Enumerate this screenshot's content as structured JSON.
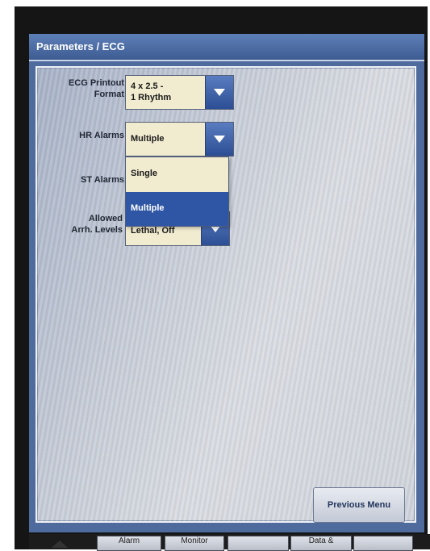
{
  "window": {
    "title": "Parameters / ECG"
  },
  "fields": {
    "printout": {
      "label": "ECG Printout\nFormat",
      "value": "4 x 2.5 -\n1 Rhythm"
    },
    "hr_alarms": {
      "label": "HR Alarms",
      "value": "Multiple"
    },
    "st_alarms": {
      "label": "ST Alarms"
    },
    "arrh_levels": {
      "label": "Allowed\nArrh. Levels",
      "value": "Lethal, Off"
    }
  },
  "dropdown": {
    "options": [
      "Single",
      "Multiple"
    ],
    "selected": "Multiple"
  },
  "buttons": {
    "previous_menu": "Previous Menu"
  },
  "bottom_tabs": [
    "Alarm",
    "Monitor",
    "Data &"
  ],
  "colors": {
    "title_bar": "#3e5c92",
    "selected_option": "#2f56a5",
    "field_bg": "#f1ebcf"
  }
}
